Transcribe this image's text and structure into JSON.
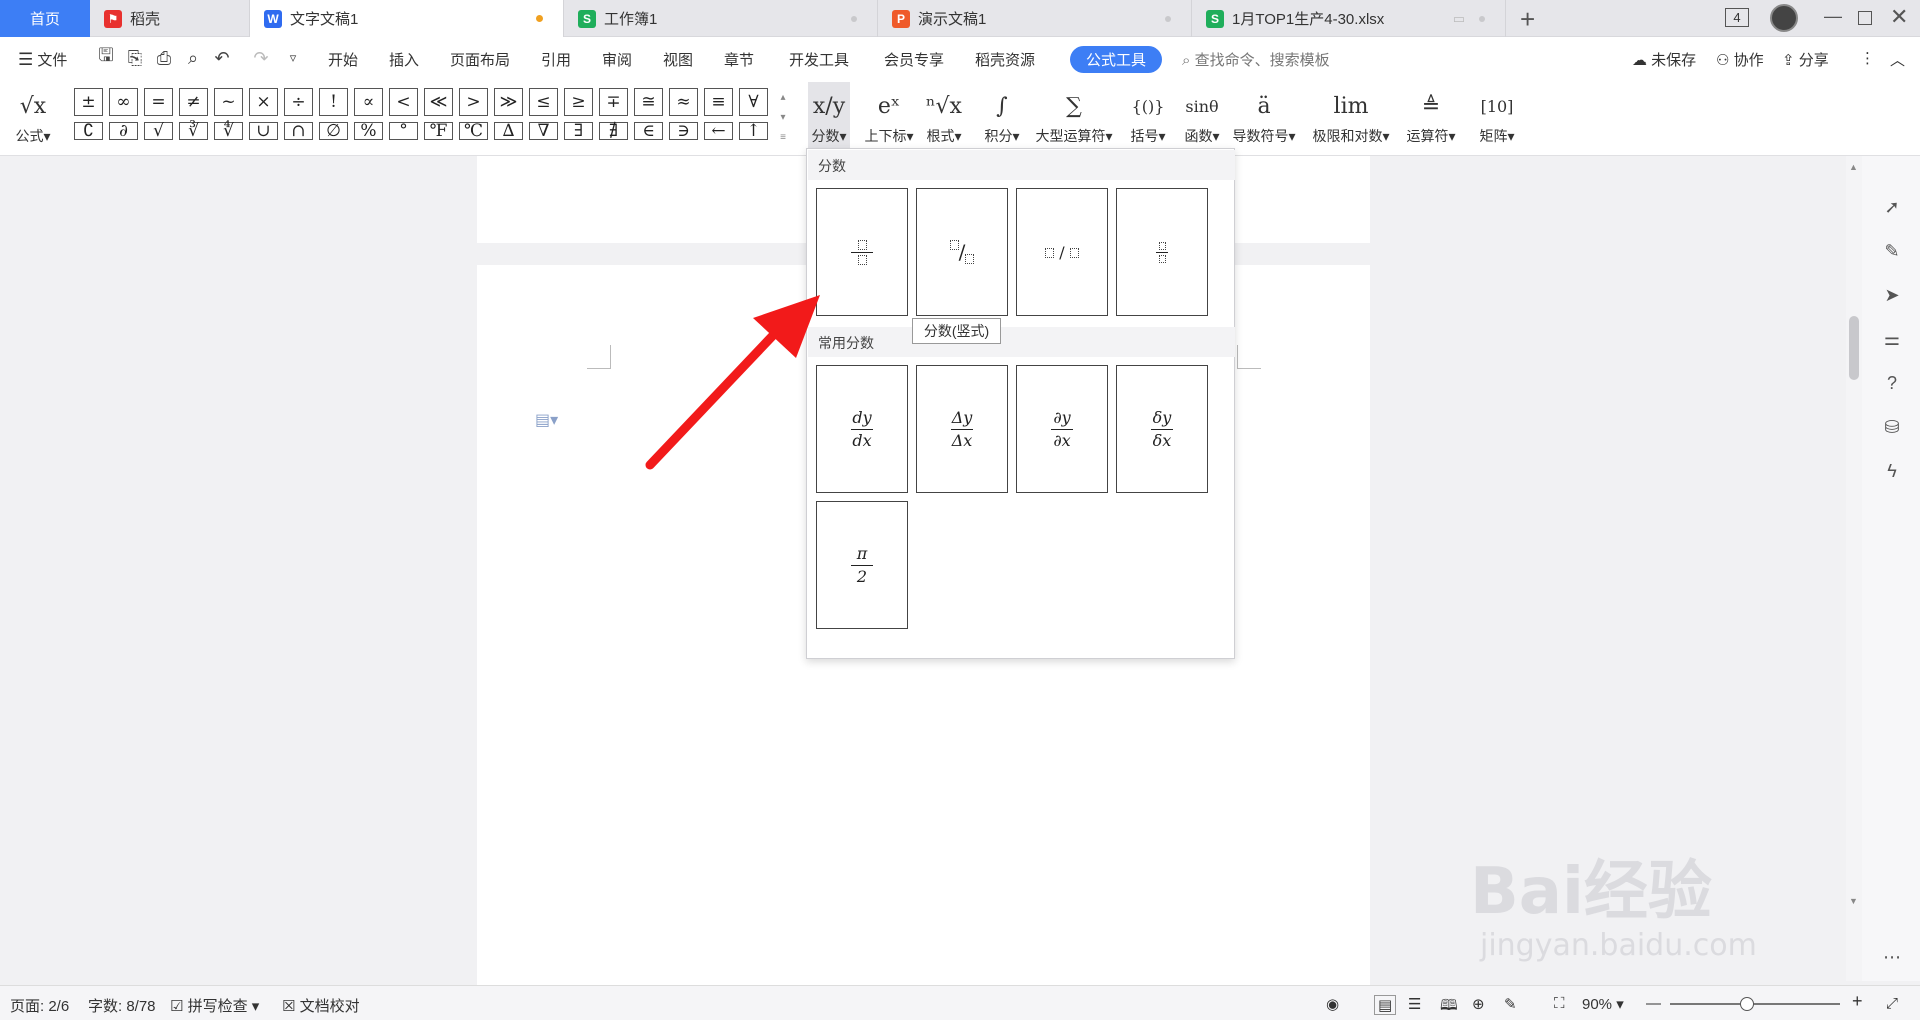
{
  "tabs": [
    {
      "label": "首页",
      "active": false,
      "home": true
    },
    {
      "label": "稻壳",
      "icon": "daoke-icon",
      "color": "#e8312f"
    },
    {
      "label": "文字文稿1",
      "icon": "writer-icon",
      "color": "#2f6bf0",
      "active": true,
      "modified": true
    },
    {
      "label": "工作簿1",
      "icon": "spreadsheet-icon",
      "color": "#1fae5b"
    },
    {
      "label": "演示文稿1",
      "icon": "presentation-icon",
      "color": "#ef5a2a"
    },
    {
      "label": "1月TOP1生产4-30.xlsx",
      "icon": "spreadsheet-icon",
      "color": "#1fae5b"
    }
  ],
  "window": {
    "badge": "4"
  },
  "menu": {
    "file": "文件",
    "items": [
      "开始",
      "插入",
      "页面布局",
      "引用",
      "审阅",
      "视图",
      "章节",
      "开发工具",
      "会员专享",
      "稻壳资源"
    ],
    "active_tab": "公式工具",
    "search_placeholder": "查找命令、搜索模板",
    "unsaved": "未保存",
    "collab": "协作",
    "share": "分享"
  },
  "ribbon": {
    "formula_label": "公式",
    "symbols_row1": [
      "±",
      "∞",
      "=",
      "≠",
      "~",
      "×",
      "÷",
      "!",
      "∝",
      "<",
      "≪",
      ">",
      "≫",
      "≤",
      "≥",
      "∓",
      "≅",
      "≈",
      "≡",
      "∀"
    ],
    "symbols_row2": [
      "∁",
      "∂",
      "√",
      "∛",
      "∜",
      "∪",
      "∩",
      "∅",
      "%",
      "°",
      "℉",
      "℃",
      "∆",
      "∇",
      "∃",
      "∄",
      "∈",
      "∋",
      "←",
      "↑"
    ],
    "groups": [
      {
        "label": "分数",
        "glyph": "x/y"
      },
      {
        "label": "上下标",
        "glyph": "eˣ"
      },
      {
        "label": "根式",
        "glyph": "ⁿ√x"
      },
      {
        "label": "积分",
        "glyph": "∫"
      },
      {
        "label": "大型运算符",
        "glyph": "∑"
      },
      {
        "label": "括号",
        "glyph": "{()}"
      },
      {
        "label": "函数",
        "glyph": "sinθ"
      },
      {
        "label": "导数符号",
        "glyph": "ä"
      },
      {
        "label": "极限和对数",
        "glyph": "lim"
      },
      {
        "label": "运算符",
        "glyph": "≜"
      },
      {
        "label": "矩阵",
        "glyph": "[10]"
      }
    ]
  },
  "dropdown": {
    "section1": "分数",
    "section2": "常用分数",
    "tooltip": "分数(竖式)",
    "common": [
      {
        "num": "dy",
        "den": "dx"
      },
      {
        "num": "Δy",
        "den": "Δx"
      },
      {
        "num": "∂y",
        "den": "∂x"
      },
      {
        "num": "δy",
        "den": "δx"
      },
      {
        "num": "π",
        "den": "2"
      }
    ]
  },
  "status": {
    "page": "页面: 2/6",
    "words": "字数: 8/78",
    "spell": "拼写检查",
    "proof": "文档校对",
    "zoom": "90%"
  },
  "watermark": {
    "text": "Bai经验",
    "sub": "jingyan.baidu.com"
  }
}
